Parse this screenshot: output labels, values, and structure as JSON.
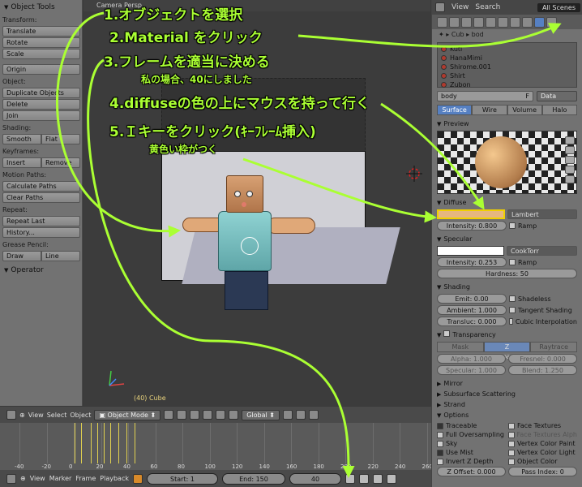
{
  "toolshelf": {
    "header": "Object Tools",
    "transform_label": "Transform:",
    "transform_btns": [
      "Translate",
      "Rotate",
      "Scale"
    ],
    "origin_btn": "Origin",
    "object_label": "Object:",
    "object_btns": [
      "Duplicate Objects",
      "Delete",
      "Join"
    ],
    "shading_label": "Shading:",
    "shading_btns": [
      "Smooth",
      "Flat"
    ],
    "keyframes_label": "Keyframes:",
    "keyframe_btns": [
      "Insert",
      "Remove"
    ],
    "motion_label": "Motion Paths:",
    "motion_btns": [
      "Calculate Paths",
      "Clear Paths"
    ],
    "repeat_label": "Repeat:",
    "repeat_btns": [
      "Repeat Last",
      "History..."
    ],
    "grease_label": "Grease Pencil:",
    "grease_btns": [
      "Draw",
      "Line"
    ],
    "operator": "Operator"
  },
  "viewport": {
    "name": "Camera Persp",
    "object_label": "(40) Cube"
  },
  "props": {
    "top_menu": [
      "View",
      "Search"
    ],
    "scene": "All Scenes",
    "path": [
      "Cub",
      "bod"
    ],
    "materials": [
      "Kuti",
      "HanaMimi",
      "Shirome.001",
      "Shirt",
      "Zubon"
    ],
    "mat_name": "body",
    "mat_flag": "F",
    "mat_type": "Data",
    "mat_tabs": [
      "Surface",
      "Wire",
      "Volume",
      "Halo"
    ],
    "preview": "Preview",
    "diffuse": "Diffuse",
    "diffuse_shader": "Lambert",
    "intensity": "Intensity: 0.800",
    "ramp": "Ramp",
    "specular": "Specular",
    "spec_shader": "CookTorr",
    "spec_intensity": "Intensity: 0.253",
    "spec_ramp": "Ramp",
    "hardness": "Hardness: 50",
    "shading": "Shading",
    "emit": "Emit: 0.00",
    "ambient": "Ambient: 1.000",
    "translucency": "Transluc: 0.000",
    "shadeless": "Shadeless",
    "tangent": "Tangent Shading",
    "cubic": "Cubic Interpolation",
    "transparency": "Transparency",
    "trans_tabs": [
      "Mask",
      "Z Transparency",
      "Raytrace"
    ],
    "alpha": "Alpha: 1.000",
    "fresnel": "Fresnel: 0.000",
    "specular_t": "Specular: 1.000",
    "blend": "Blend: 1.250",
    "mirror": "Mirror",
    "sss": "Subsurface Scattering",
    "strand": "Strand",
    "options": "Options",
    "opt_left": [
      "Traceable",
      "Full Oversampling",
      "Sky",
      "Use Mist",
      "Invert Z Depth",
      "Z Offset: 0.000"
    ],
    "opt_right": [
      "Face Textures",
      "Face Textures Alph",
      "Vertex Color Paint",
      "Vertex Color Light",
      "Object Color",
      "Pass Index: 0"
    ]
  },
  "timeline_header": {
    "menus": [
      "View",
      "Select",
      "Object"
    ],
    "mode": "Object Mode",
    "orientation": "Global"
  },
  "timeline": {
    "frame_labels": [
      "-40",
      "-20",
      "0",
      "20",
      "40",
      "60",
      "80",
      "100",
      "120",
      "140",
      "160",
      "180",
      "200",
      "220",
      "240",
      "260"
    ]
  },
  "timeline_bottom": {
    "menus": [
      "View",
      "Marker",
      "Frame",
      "Playback"
    ],
    "start": "Start: 1",
    "end": "End: 150",
    "current": "40"
  },
  "annotations": {
    "step1": "1.オブジェクトを選択",
    "step2": "2.Material をクリック",
    "step3": "3.フレームを適当に決める",
    "step3_note": "私の場合、40にしました",
    "step4": "4.diffuseの色の上にマウスを持って行く",
    "step5": "5.Ｉキーをクリック(ｷｰﾌﾚｰﾑ挿入)",
    "step5_note": "黄色い枠がつく"
  },
  "colors": {
    "annotation": "#aaff33",
    "diffuse": "#e6b780",
    "keyframe_border": "#f0d000",
    "active_tab": "#5680c2"
  }
}
